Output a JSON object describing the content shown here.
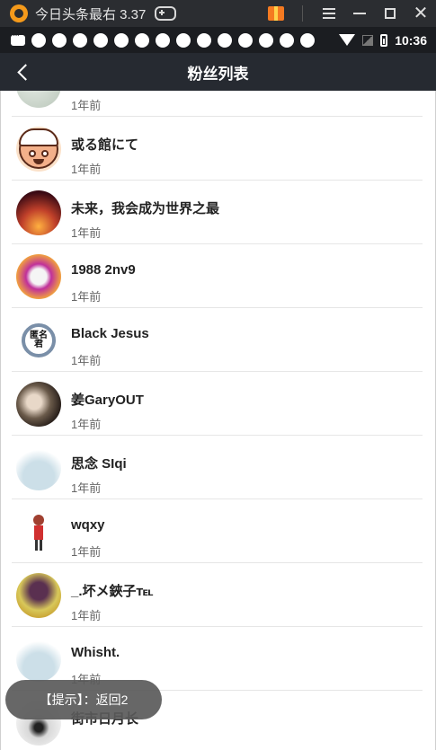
{
  "emulator": {
    "title": "今日头条最右 3.37"
  },
  "status_bar": {
    "time": "10:36",
    "notification_count": 14
  },
  "header": {
    "title": "粉丝列表"
  },
  "followers": [
    {
      "name": "",
      "time": "1年前"
    },
    {
      "name": "或る館にて",
      "time": "1年前"
    },
    {
      "name": "未来，我会成为世界之最",
      "time": "1年前"
    },
    {
      "name": "1988 2nv9",
      "time": "1年前"
    },
    {
      "name": "Black Jesus",
      "time": "1年前"
    },
    {
      "name": "姜GaryOUT",
      "time": "1年前"
    },
    {
      "name": "思念 SIqi",
      "time": "1年前"
    },
    {
      "name": "wqxy",
      "time": "1年前"
    },
    {
      "name": "_.坏メ鋏子℡",
      "time": "1年前"
    },
    {
      "name": "Whisht.",
      "time": "1年前"
    },
    {
      "name": "街市日月长",
      "time": ""
    }
  ],
  "anon_badge_text": "匿名君",
  "toast": {
    "text": "【提示】：返回2"
  }
}
